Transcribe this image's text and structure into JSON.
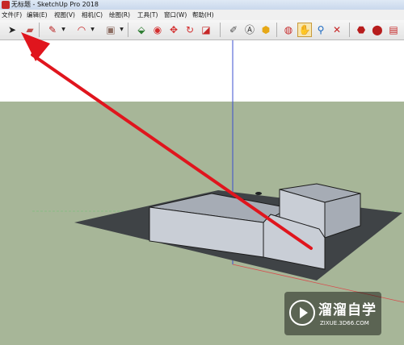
{
  "window": {
    "title": "无标题 - SketchUp Pro 2018"
  },
  "menu": [
    "文件(F)",
    "编辑(E)",
    "视图(V)",
    "相机(C)",
    "绘图(R)",
    "工具(T)",
    "窗口(W)",
    "帮助(H)"
  ],
  "toolbar": [
    {
      "name": "select-tool",
      "glyph": "➤",
      "color": "#222222",
      "active": false
    },
    {
      "name": "eraser-tool",
      "glyph": "▰",
      "color": "#c0504d",
      "active": false
    },
    {
      "name": "pencil-tool",
      "glyph": "✎",
      "color": "#b71c1c",
      "active": false
    },
    {
      "name": "arc-tool",
      "glyph": "◠",
      "color": "#c62828",
      "active": false
    },
    {
      "name": "rectangle-tool",
      "glyph": "▣",
      "color": "#8d6e63",
      "active": false
    },
    {
      "name": "push-pull-tool",
      "glyph": "⬙",
      "color": "#2e7d32",
      "active": false
    },
    {
      "name": "follow-me-tool",
      "glyph": "◉",
      "color": "#d32f2f",
      "active": false
    },
    {
      "name": "move-tool",
      "glyph": "✥",
      "color": "#d32f2f",
      "active": false
    },
    {
      "name": "rotate-tool",
      "glyph": "↻",
      "color": "#d32f2f",
      "active": false
    },
    {
      "name": "scale-tool",
      "glyph": "◪",
      "color": "#c62828",
      "active": false
    },
    {
      "name": "tape-measure-tool",
      "glyph": "✐",
      "color": "#555555",
      "active": false
    },
    {
      "name": "text-tool",
      "glyph": "Ⓐ",
      "color": "#333333",
      "active": false
    },
    {
      "name": "paint-bucket-tool",
      "glyph": "⬢",
      "color": "#e6a817",
      "active": false
    },
    {
      "name": "orbit-tool",
      "glyph": "◍",
      "color": "#c62828",
      "active": false
    },
    {
      "name": "pan-tool",
      "glyph": "✋",
      "color": "#333333",
      "active": true
    },
    {
      "name": "zoom-tool",
      "glyph": "⚲",
      "color": "#1565c0",
      "active": false
    },
    {
      "name": "zoom-extents-tool",
      "glyph": "✕",
      "color": "#c62828",
      "active": false
    },
    {
      "name": "warehouse-tool",
      "glyph": "⬣",
      "color": "#b71c1c",
      "active": false
    },
    {
      "name": "extension-tool",
      "glyph": "⬤",
      "color": "#b71c1c",
      "active": false
    },
    {
      "name": "layout-tool",
      "glyph": "▤",
      "color": "#c62828",
      "active": false
    }
  ],
  "watermark": {
    "brand": "溜溜自学",
    "url": "ZIXUE.3D66.COM"
  },
  "colors": {
    "sky": "#ffffff",
    "ground": "#a7b698",
    "base": "#3f4346",
    "box_light": "#c9ced6",
    "box_dark": "#a6acb5",
    "arrow": "#e0151d"
  }
}
